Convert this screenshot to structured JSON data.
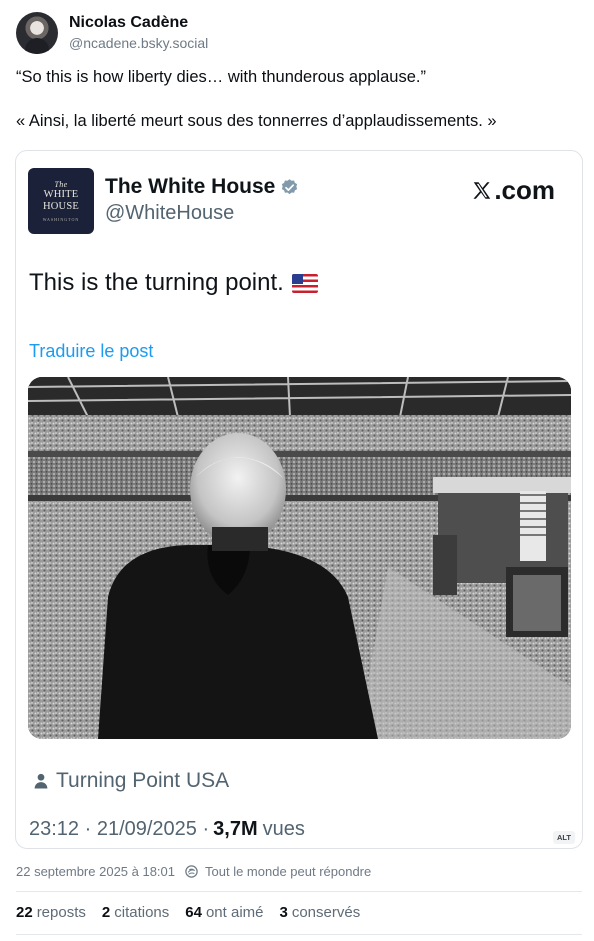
{
  "author": {
    "display_name": "Nicolas Cadène",
    "handle": "@ncadene.bsky.social"
  },
  "post": {
    "text_en": "“So this is how liberty dies… with thunderous applause.”",
    "text_fr": "« Ainsi, la liberté meurt sous des tonnerres d’applaudissements. »"
  },
  "embed": {
    "logo_the": "The",
    "logo_line1": "WHITE",
    "logo_line2": "HOUSE",
    "logo_tiny": "WASHINGTON",
    "account_name": "The White House",
    "account_handle": "@WhiteHouse",
    "site_label": ".com",
    "tweet_text": "This is the turning point.",
    "translate_label": "Traduire le post",
    "location": "Turning Point USA",
    "timestamp": "23:12 · 21/09/2025 ·",
    "views_count": "3,7M",
    "views_label": "vues",
    "alt_label": "ALT"
  },
  "footer": {
    "date": "22 septembre 2025 à 18:01",
    "reply_setting": "Tout le monde peut répondre"
  },
  "stats": [
    {
      "count": "22",
      "label": "reposts"
    },
    {
      "count": "2",
      "label": "citations"
    },
    {
      "count": "64",
      "label": "ont aimé"
    },
    {
      "count": "3",
      "label": "conservés"
    }
  ],
  "icons": {
    "verified": "verified-badge-icon",
    "x": "x-logo-icon",
    "flag": "us-flag-icon",
    "location": "person-icon",
    "reply": "reply-setting-icon"
  },
  "colors": {
    "link": "#1d9bf0",
    "muted": "#536471",
    "logo_bg": "#1a2138"
  }
}
